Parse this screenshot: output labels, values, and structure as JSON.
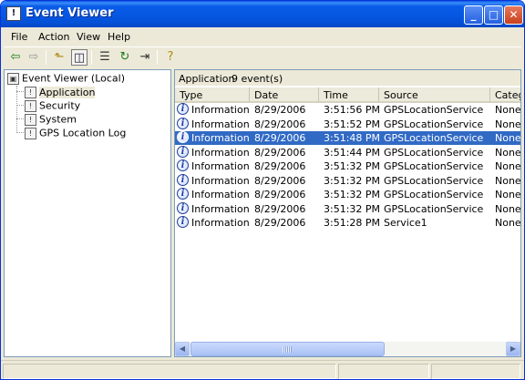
{
  "window": {
    "title": "Event Viewer"
  },
  "menu": [
    "File",
    "Action",
    "View",
    "Help"
  ],
  "tree": {
    "root": "Event Viewer (Local)",
    "items": [
      "Application",
      "Security",
      "System",
      "GPS Location Log"
    ],
    "selected": "Application"
  },
  "pane": {
    "title": "Application",
    "count_text": "9 event(s)"
  },
  "columns": [
    "Type",
    "Date",
    "Time",
    "Source",
    "Catego"
  ],
  "rows": [
    {
      "type": "Information",
      "date": "8/29/2006",
      "time": "3:51:56 PM",
      "source": "GPSLocationService",
      "category": "None"
    },
    {
      "type": "Information",
      "date": "8/29/2006",
      "time": "3:51:52 PM",
      "source": "GPSLocationService",
      "category": "None"
    },
    {
      "type": "Information",
      "date": "8/29/2006",
      "time": "3:51:48 PM",
      "source": "GPSLocationService",
      "category": "None"
    },
    {
      "type": "Information",
      "date": "8/29/2006",
      "time": "3:51:44 PM",
      "source": "GPSLocationService",
      "category": "None"
    },
    {
      "type": "Information",
      "date": "8/29/2006",
      "time": "3:51:32 PM",
      "source": "GPSLocationService",
      "category": "None"
    },
    {
      "type": "Information",
      "date": "8/29/2006",
      "time": "3:51:32 PM",
      "source": "GPSLocationService",
      "category": "None"
    },
    {
      "type": "Information",
      "date": "8/29/2006",
      "time": "3:51:32 PM",
      "source": "GPSLocationService",
      "category": "None"
    },
    {
      "type": "Information",
      "date": "8/29/2006",
      "time": "3:51:32 PM",
      "source": "GPSLocationService",
      "category": "None"
    },
    {
      "type": "Information",
      "date": "8/29/2006",
      "time": "3:51:28 PM",
      "source": "Service1",
      "category": "None"
    }
  ],
  "selected_row": 2,
  "colors": {
    "titlebar": "#0a5ce8",
    "selection": "#316ac5",
    "chrome": "#ece9d8"
  },
  "icons": {
    "back": "back-arrow-icon",
    "forward": "forward-arrow-icon",
    "up": "up-folder-icon",
    "show_hide_tree": "show-hide-tree-icon",
    "properties": "properties-icon",
    "refresh": "refresh-icon",
    "export": "export-list-icon",
    "help": "help-icon",
    "event_info": "information-icon"
  }
}
